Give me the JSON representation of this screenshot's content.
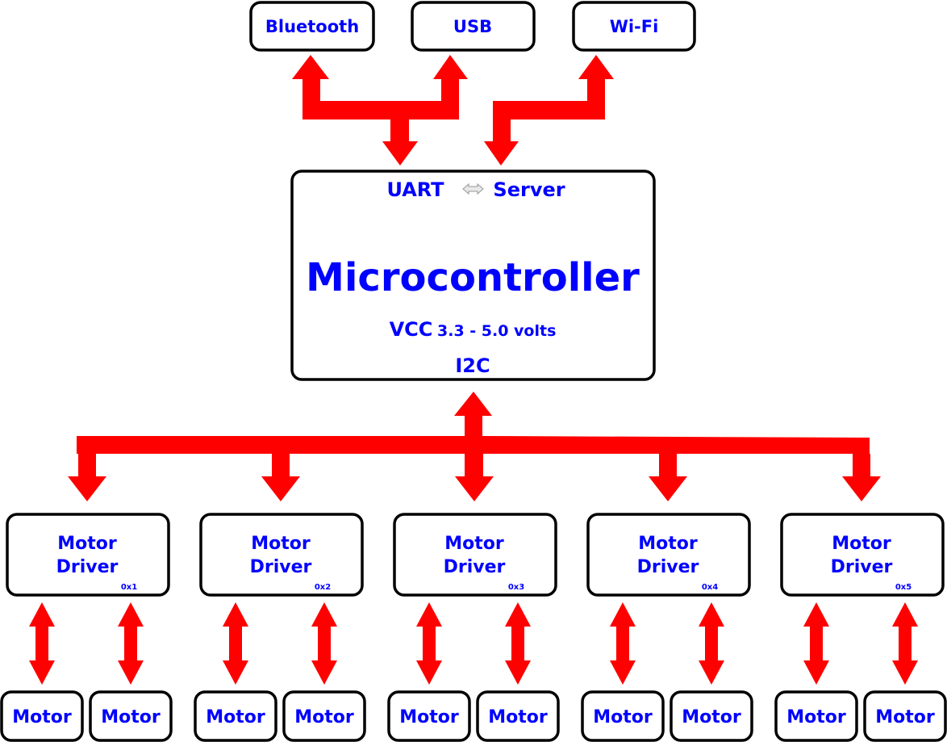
{
  "colors": {
    "arrow": "#ff0000",
    "text": "#0000ff",
    "border": "#000000",
    "uart_server_arrow": "#c0c0c0"
  },
  "interfaces": [
    {
      "label": "Bluetooth"
    },
    {
      "label": "USB"
    },
    {
      "label": "Wi-Fi"
    }
  ],
  "microcontroller": {
    "title": "Microcontroller",
    "uart": "UART",
    "server": "Server",
    "vcc_label": "VCC",
    "vcc_range": "3.3 - 5.0 volts",
    "bus": "I2C"
  },
  "drivers": [
    {
      "label_line1": "Motor",
      "label_line2": "Driver",
      "address": "0x1",
      "motors": [
        "Motor",
        "Motor"
      ]
    },
    {
      "label_line1": "Motor",
      "label_line2": "Driver",
      "address": "0x2",
      "motors": [
        "Motor",
        "Motor"
      ]
    },
    {
      "label_line1": "Motor",
      "label_line2": "Driver",
      "address": "0x3",
      "motors": [
        "Motor",
        "Motor"
      ]
    },
    {
      "label_line1": "Motor",
      "label_line2": "Driver",
      "address": "0x4",
      "motors": [
        "Motor",
        "Motor"
      ]
    },
    {
      "label_line1": "Motor",
      "label_line2": "Driver",
      "address": "0x5",
      "motors": [
        "Motor",
        "Motor"
      ]
    }
  ]
}
